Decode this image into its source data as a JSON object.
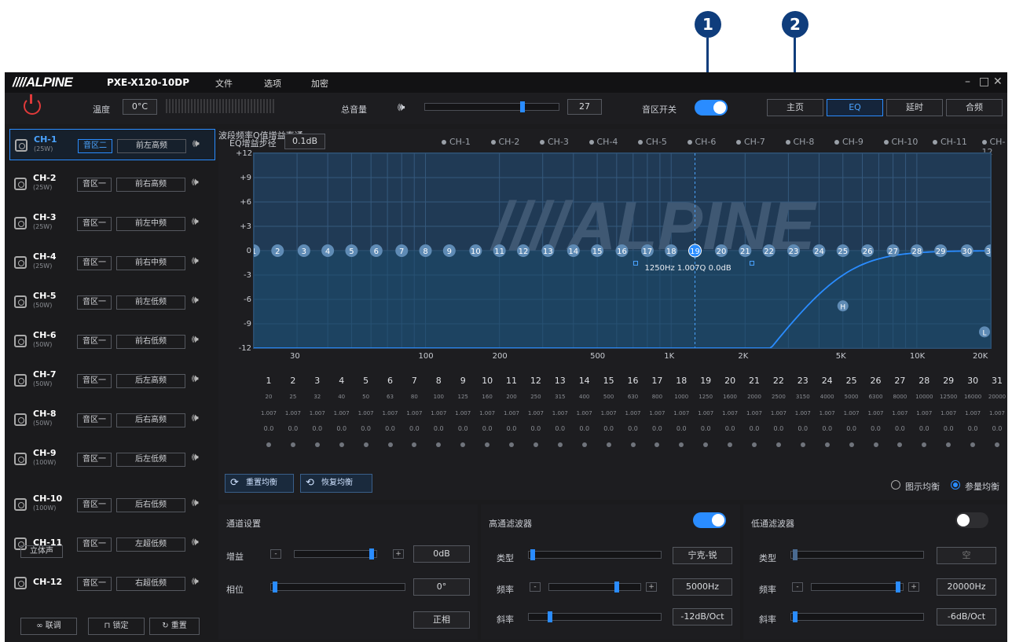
{
  "callouts": [
    "1",
    "2"
  ],
  "titlebar": {
    "logo": "////ALPINE",
    "model": "PXE-X120-10DP",
    "menu": [
      "文件",
      "选项",
      "加密"
    ],
    "min": "–",
    "max": "□",
    "close": "✕"
  },
  "toolbar": {
    "temp_label": "温度",
    "temp_value": "0°C",
    "master_label": "总音量",
    "master_value": "27",
    "master_level": 0.74,
    "zone_label": "音区开关",
    "zone_on": true,
    "buttons": [
      "主页",
      "EQ",
      "延时",
      "合频"
    ],
    "active": "EQ"
  },
  "channels": [
    {
      "name": "CH-1",
      "power": "(25W)",
      "zone": "音区二",
      "pos": "前左高频"
    },
    {
      "name": "CH-2",
      "power": "(25W)",
      "zone": "音区一",
      "pos": "前右高频"
    },
    {
      "name": "CH-3",
      "power": "(25W)",
      "zone": "音区一",
      "pos": "前左中频"
    },
    {
      "name": "CH-4",
      "power": "(25W)",
      "zone": "音区一",
      "pos": "前右中频"
    },
    {
      "name": "CH-5",
      "power": "(50W)",
      "zone": "音区一",
      "pos": "前左低频"
    },
    {
      "name": "CH-6",
      "power": "(50W)",
      "zone": "音区一",
      "pos": "前右低频"
    },
    {
      "name": "CH-7",
      "power": "(50W)",
      "zone": "音区一",
      "pos": "后左高频"
    },
    {
      "name": "CH-8",
      "power": "(50W)",
      "zone": "音区一",
      "pos": "后右高频"
    },
    {
      "name": "CH-9",
      "power": "(100W)",
      "zone": "音区一",
      "pos": "后左低频"
    },
    {
      "name": "CH-10",
      "power": "(100W)",
      "zone": "音区一",
      "pos": "后右低频"
    },
    {
      "name": "CH-11",
      "power": "",
      "zone": "音区一",
      "pos": "左超低频"
    },
    {
      "name": "CH-12",
      "power": "",
      "zone": "音区一",
      "pos": "右超低频"
    }
  ],
  "stereo": "立体声",
  "bottom_buttons": [
    "联调",
    "锁定",
    "重置"
  ],
  "eq": {
    "step_label": "EQ增益步径",
    "step_value": "0.1dB",
    "legend": [
      "CH-1",
      "CH-2",
      "CH-3",
      "CH-4",
      "CH-5",
      "CH-6",
      "CH-7",
      "CH-8",
      "CH-9",
      "CH-10",
      "CH-11",
      "CH-12"
    ],
    "y_ticks": [
      "+12",
      "+9",
      "+6",
      "+3",
      "0",
      "-3",
      "-6",
      "-9",
      "-12"
    ],
    "x_ticks": [
      "30",
      "100",
      "200",
      "500",
      "1K",
      "2K",
      "5K",
      "10K",
      "20K"
    ],
    "watermark": "////ALPINE",
    "readout": "1250Hz  1.007Q  0.0dB",
    "h_marker": "H",
    "l_marker": "L",
    "row_labels": [
      "波段",
      "频率",
      "Q值",
      "增益",
      "直通"
    ],
    "bands": [
      "1",
      "2",
      "3",
      "4",
      "5",
      "6",
      "7",
      "8",
      "9",
      "10",
      "11",
      "12",
      "13",
      "14",
      "15",
      "16",
      "17",
      "18",
      "19",
      "20",
      "21",
      "22",
      "23",
      "24",
      "25",
      "26",
      "27",
      "28",
      "29",
      "30",
      "31"
    ],
    "freqs": [
      "20",
      "25",
      "32",
      "40",
      "50",
      "63",
      "80",
      "100",
      "125",
      "160",
      "200",
      "250",
      "315",
      "400",
      "500",
      "630",
      "800",
      "1000",
      "1250",
      "1600",
      "2000",
      "2500",
      "3150",
      "4000",
      "5000",
      "6300",
      "8000",
      "10000",
      "12500",
      "16000",
      "20000"
    ],
    "q": "1.007",
    "gain": "0.0",
    "reset_btn": "重置均衡",
    "restore_btn": "恢复均衡",
    "graphic_eq": "图示均衡",
    "param_eq": "参量均衡"
  },
  "channel_settings": {
    "title": "通道设置",
    "gain_label": "增益",
    "gain_value": "0dB",
    "gain_level": 0.97,
    "phase_label": "相位",
    "phase_value": "0°",
    "phase_btn": "正相",
    "minus": "-",
    "plus": "+"
  },
  "highpass": {
    "title": "高通滤波器",
    "on": true,
    "type_label": "类型",
    "type_value": "宁克-锐",
    "freq_label": "频率",
    "freq_value": "5000Hz",
    "freq_level": 0.75,
    "slope_label": "斜率",
    "slope_value": "-12dB/Oct"
  },
  "lowpass": {
    "title": "低通滤波器",
    "on": false,
    "type_label": "类型",
    "type_value": "空",
    "freq_label": "频率",
    "freq_value": "20000Hz",
    "freq_level": 0.97,
    "slope_label": "斜率",
    "slope_value": "-6dB/Oct"
  }
}
